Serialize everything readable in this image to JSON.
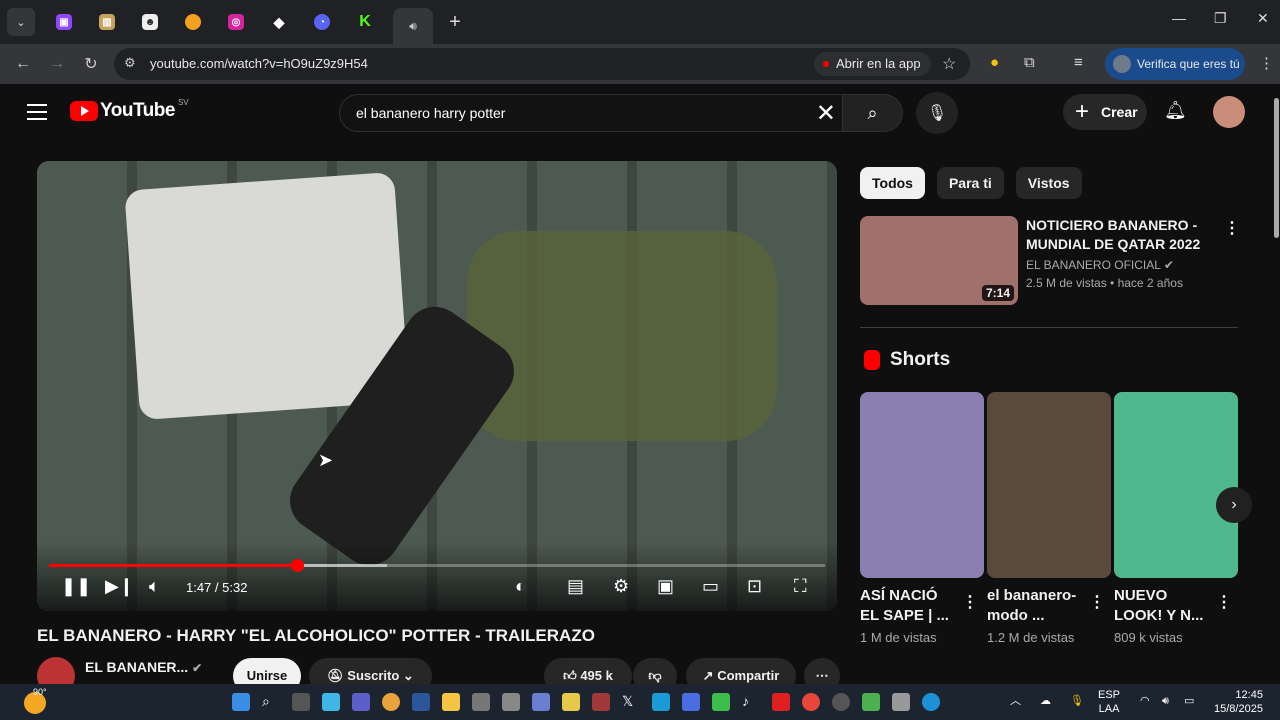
{
  "browser": {
    "url": "youtube.com/watch?v=hO9uZ9z9H54",
    "open_in_app": "Abrir en la app",
    "verify": "Verifica que eres tú",
    "tabs": [
      "twitch-icon",
      "box-icon",
      "ghost-icon",
      "chrome-icon",
      "instagram-icon",
      "diamond-icon",
      "cursor-icon",
      "kick-icon"
    ]
  },
  "youtube": {
    "logo_text": "YouTube",
    "country": "SV",
    "search_query": "el bananero harry potter",
    "create_label": "Crear"
  },
  "player": {
    "time": "1:47 / 5:32",
    "progress_fraction": 0.32,
    "buffered_fraction": 0.435
  },
  "video": {
    "title": "EL BANANERO - HARRY \"EL ALCOHOLICO\" POTTER - TRAILERAZO",
    "channel": "EL BANANER...",
    "join_label": "Unirse",
    "subscribed_label": "Suscrito",
    "likes": "495 k",
    "share_label": "Compartir"
  },
  "chips": [
    "Todos",
    "Para ti",
    "Vistos"
  ],
  "recommended": {
    "title": "NOTICIERO BANANERO - MUNDIAL DE QATAR 2022",
    "channel": "EL BANANERO OFICIAL",
    "meta": "2.5 M de vistas • hace 2 años",
    "duration": "7:14"
  },
  "shorts": {
    "header": "Shorts",
    "items": [
      {
        "title": "ASÍ NACIÓ EL SAPE | ...",
        "views": "1 M de vistas",
        "color": "#8a7fb0"
      },
      {
        "title": "el bananero- modo ...",
        "views": "1.2 M de vistas",
        "color": "#5a4a3c"
      },
      {
        "title": "NUEVO LOOK! Y N...",
        "views": "809 k vistas",
        "color": "#4fb88c"
      }
    ]
  },
  "taskbar": {
    "weather_temp": "90°",
    "lang_1": "ESP",
    "lang_2": "LAA",
    "time": "12:45",
    "date": "15/8/2025"
  }
}
